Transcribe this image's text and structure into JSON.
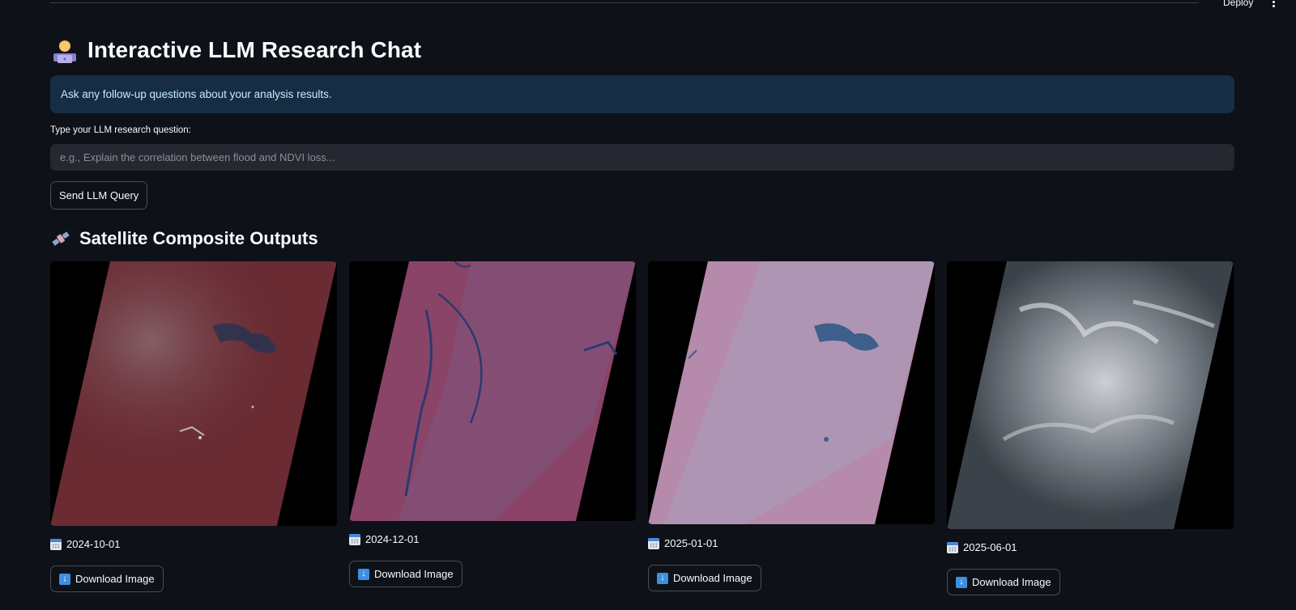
{
  "topbar": {
    "deploy_label": "Deploy",
    "menu_icon": "kebab-menu-icon"
  },
  "header": {
    "title": "Interactive LLM Research Chat",
    "icon": "technologist-emoji-icon"
  },
  "info": {
    "text": "Ask any follow-up questions about your analysis results."
  },
  "query": {
    "label": "Type your LLM research question:",
    "placeholder": "e.g., Explain the correlation between flood and NDVI loss...",
    "value": "",
    "send_label": "Send LLM Query"
  },
  "outputs": {
    "title": "Satellite Composite Outputs",
    "icon": "satellite-emoji-icon",
    "download_label": "Download Image",
    "download_icon": "down-arrow-icon",
    "date_icon": "calendar-icon",
    "items": [
      {
        "date": "2024-10-01",
        "style": "dark red vegetation composite with haze"
      },
      {
        "date": "2024-12-01",
        "style": "magenta composite with dark blue river network"
      },
      {
        "date": "2025-01-01",
        "style": "pale pink composite with reservoir"
      },
      {
        "date": "2025-06-01",
        "style": "grey cloud-covered composite"
      }
    ]
  },
  "colors": {
    "background": "#0e1117",
    "info_bg": "#172d43",
    "info_text": "#c7ebff",
    "input_bg": "#262730",
    "border": "#4a4d57"
  }
}
